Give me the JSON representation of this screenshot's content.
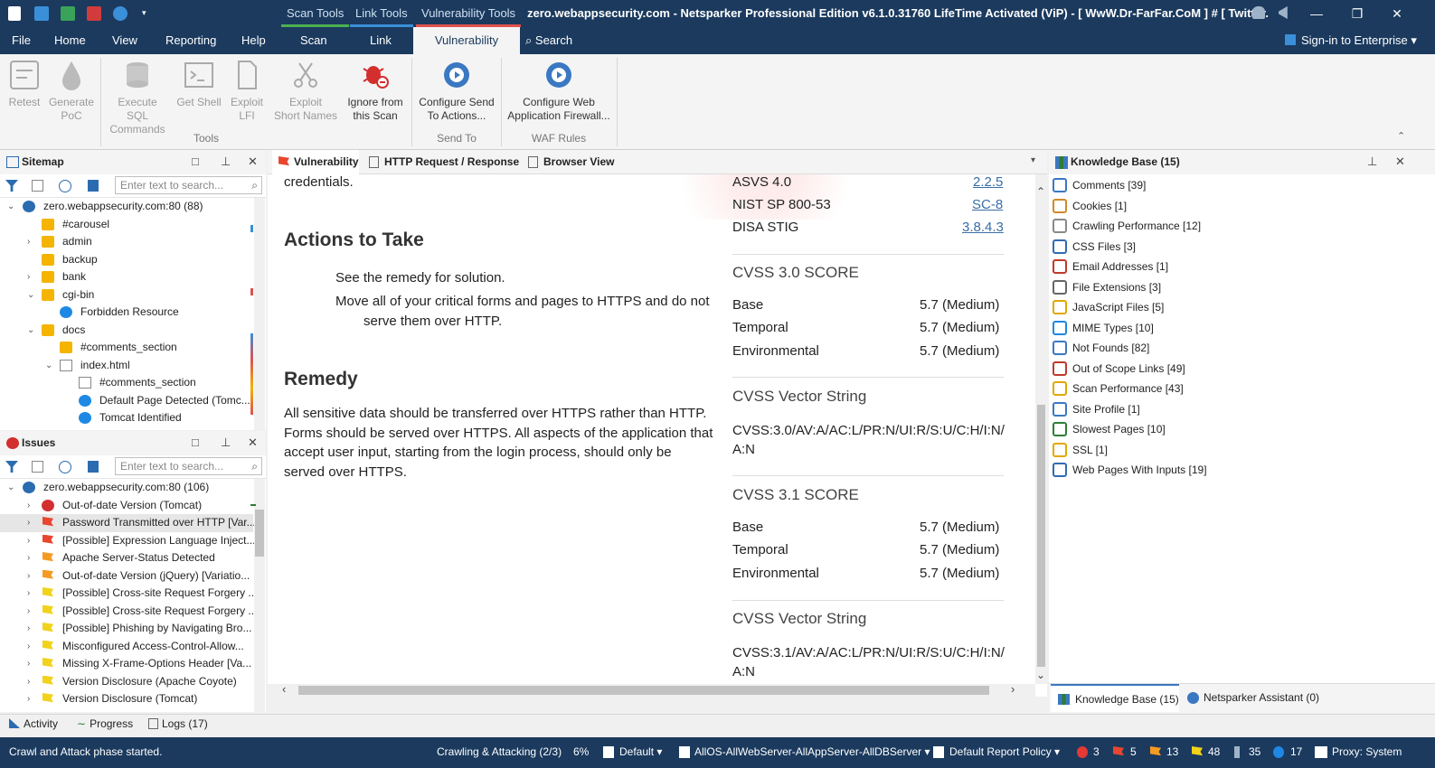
{
  "titlebar": {
    "contextual_tabs": [
      "Scan Tools",
      "Link Tools",
      "Vulnerability Tools"
    ],
    "title": "zero.webappsecurity.com - Netsparker Professional Edition v6.1.0.31760 LifeTime Activated (ViP) - [ WwW.Dr-FarFar.CoM ] # [ Twitter.CoM/3XS0 ...",
    "controls": [
      "—",
      "❐",
      "✕"
    ]
  },
  "ribbon_tabs": [
    "File",
    "Home",
    "View",
    "Reporting",
    "Help",
    "Scan",
    "Link",
    "Vulnerability",
    "Search"
  ],
  "sign_in": "Sign-in to Enterprise",
  "ribbon": {
    "buttons": [
      {
        "label1": "Retest",
        "label2": ""
      },
      {
        "label1": "Generate",
        "label2": "PoC"
      },
      {
        "label1": "Execute SQL",
        "label2": "Commands"
      },
      {
        "label1": "Get Shell",
        "label2": ""
      },
      {
        "label1": "Exploit",
        "label2": "LFI"
      },
      {
        "label1": "Exploit",
        "label2": "Short Names"
      },
      {
        "label1": "Ignore from",
        "label2": "this Scan"
      },
      {
        "label1": "Configure Send",
        "label2": "To Actions..."
      },
      {
        "label1": "Configure Web",
        "label2": "Application Firewall..."
      }
    ],
    "groups": [
      "Tools",
      "Send To",
      "WAF Rules"
    ]
  },
  "sitemap": {
    "title": "Sitemap",
    "search_placeholder": "Enter text to search...",
    "items": [
      {
        "label": "zero.webappsecurity.com:80 (88)"
      },
      {
        "label": "#carousel"
      },
      {
        "label": "admin"
      },
      {
        "label": "backup"
      },
      {
        "label": "bank"
      },
      {
        "label": "cgi-bin"
      },
      {
        "label": "Forbidden Resource"
      },
      {
        "label": "docs"
      },
      {
        "label": "#comments_section"
      },
      {
        "label": "index.html"
      },
      {
        "label": "#comments_section"
      },
      {
        "label": "Default Page Detected (Tomc..."
      },
      {
        "label": "Tomcat Identified"
      }
    ]
  },
  "issues": {
    "title": "Issues",
    "search_placeholder": "Enter text to search...",
    "items": [
      {
        "label": "zero.webappsecurity.com:80 (106)"
      },
      {
        "label": "Out-of-date Version (Tomcat)"
      },
      {
        "label": "Password Transmitted over HTTP [Var..."
      },
      {
        "label": "[Possible] Expression Language Inject..."
      },
      {
        "label": "Apache Server-Status Detected"
      },
      {
        "label": "Out-of-date Version (jQuery) [Variatio..."
      },
      {
        "label": "[Possible] Cross-site Request Forgery ..."
      },
      {
        "label": "[Possible] Cross-site Request Forgery ..."
      },
      {
        "label": "[Possible] Phishing by Navigating Bro..."
      },
      {
        "label": "Misconfigured Access-Control-Allow..."
      },
      {
        "label": "Missing X-Frame-Options Header [Va..."
      },
      {
        "label": "Version Disclosure (Apache Coyote)"
      },
      {
        "label": "Version Disclosure (Tomcat)"
      }
    ]
  },
  "center_tabs": [
    "Vulnerability",
    "HTTP Request / Response",
    "Browser View"
  ],
  "doc": {
    "credentials": "credentials.",
    "actions_heading": "Actions to Take",
    "action1": "See the remedy for solution.",
    "action2a": "Move all of your critical forms and pages to HTTPS and do not",
    "action2b": "serve them over HTTP.",
    "remedy_heading": "Remedy",
    "remedy_lines": [
      "All sensitive data should be transferred over HTTPS rather than HTTP.",
      "Forms should be served over HTTPS. All aspects of the application that",
      "accept user input, starting from the login process, should only be",
      "served over HTTPS."
    ],
    "classifications": [
      {
        "name": "ASVS 4.0",
        "value": "2.2.5"
      },
      {
        "name": "NIST SP 800-53",
        "value": "SC-8"
      },
      {
        "name": "DISA STIG",
        "value": "3.8.4.3"
      }
    ],
    "cvss30_title": "CVSS 3.0 SCORE",
    "cvss30": [
      {
        "name": "Base",
        "value": "5.7 (Medium)"
      },
      {
        "name": "Temporal",
        "value": "5.7 (Medium)"
      },
      {
        "name": "Environmental",
        "value": "5.7 (Medium)"
      }
    ],
    "vector30_title": "CVSS Vector String",
    "vector30_a": "CVSS:3.0/AV:A/AC:L/PR:N/UI:R/S:U/C:H/I:N/",
    "vector30_b": "A:N",
    "cvss31_title": "CVSS 3.1 SCORE",
    "cvss31": [
      {
        "name": "Base",
        "value": "5.7 (Medium)"
      },
      {
        "name": "Temporal",
        "value": "5.7 (Medium)"
      },
      {
        "name": "Environmental",
        "value": "5.7 (Medium)"
      }
    ],
    "vector31_title": "CVSS Vector String",
    "vector31_a": "CVSS:3.1/AV:A/AC:L/PR:N/UI:R/S:U/C:H/I:N/",
    "vector31_b": "A:N"
  },
  "kb": {
    "title": "Knowledge Base (15)",
    "items": [
      {
        "label": "Comments [39]",
        "icon": "comments-icon",
        "color": "#3b78c2"
      },
      {
        "label": "Cookies [1]",
        "icon": "cookie-icon",
        "color": "#d08a2a"
      },
      {
        "label": "Crawling Performance [12]",
        "icon": "performance-table-icon",
        "color": "#8a8a8a"
      },
      {
        "label": "CSS Files [3]",
        "icon": "css-file-icon",
        "color": "#2f6bb3"
      },
      {
        "label": "Email Addresses [1]",
        "icon": "email-icon",
        "color": "#c0392b"
      },
      {
        "label": "File Extensions [3]",
        "icon": "file-icon",
        "color": "#666666"
      },
      {
        "label": "JavaScript Files [5]",
        "icon": "javascript-file-icon",
        "color": "#e0a800"
      },
      {
        "label": "MIME Types [10]",
        "icon": "info-icon",
        "color": "#1e88e5"
      },
      {
        "label": "Not Founds [82]",
        "icon": "broken-link-icon",
        "color": "#3b78c2"
      },
      {
        "label": "Out of Scope Links [49]",
        "icon": "out-of-scope-icon",
        "color": "#c0392b"
      },
      {
        "label": "Scan Performance [43]",
        "icon": "lightning-icon",
        "color": "#e0a800"
      },
      {
        "label": "Site Profile [1]",
        "icon": "site-profile-icon",
        "color": "#3b78c2"
      },
      {
        "label": "Slowest Pages [10]",
        "icon": "clock-icon",
        "color": "#2e7d32"
      },
      {
        "label": "SSL [1]",
        "icon": "lock-icon",
        "color": "#e0a800"
      },
      {
        "label": "Web Pages With Inputs [19]",
        "icon": "form-icon",
        "color": "#2f6bb3"
      }
    ],
    "tabs": [
      "Knowledge Base (15)",
      "Netsparker Assistant (0)"
    ]
  },
  "bottom_tabs": [
    "Activity",
    "Progress",
    "Logs (17)"
  ],
  "status": {
    "message": "Crawl and Attack phase started.",
    "phase": "Crawling & Attacking (2/3)",
    "percent": "6%",
    "policy": "Default",
    "profile": "AllOS-AllWebServer-AllAppServer-AllDBServer",
    "report_policy": "Default Report Policy",
    "counts": [
      "3",
      "5",
      "13",
      "48",
      "35",
      "17"
    ],
    "proxy": "Proxy: System"
  }
}
